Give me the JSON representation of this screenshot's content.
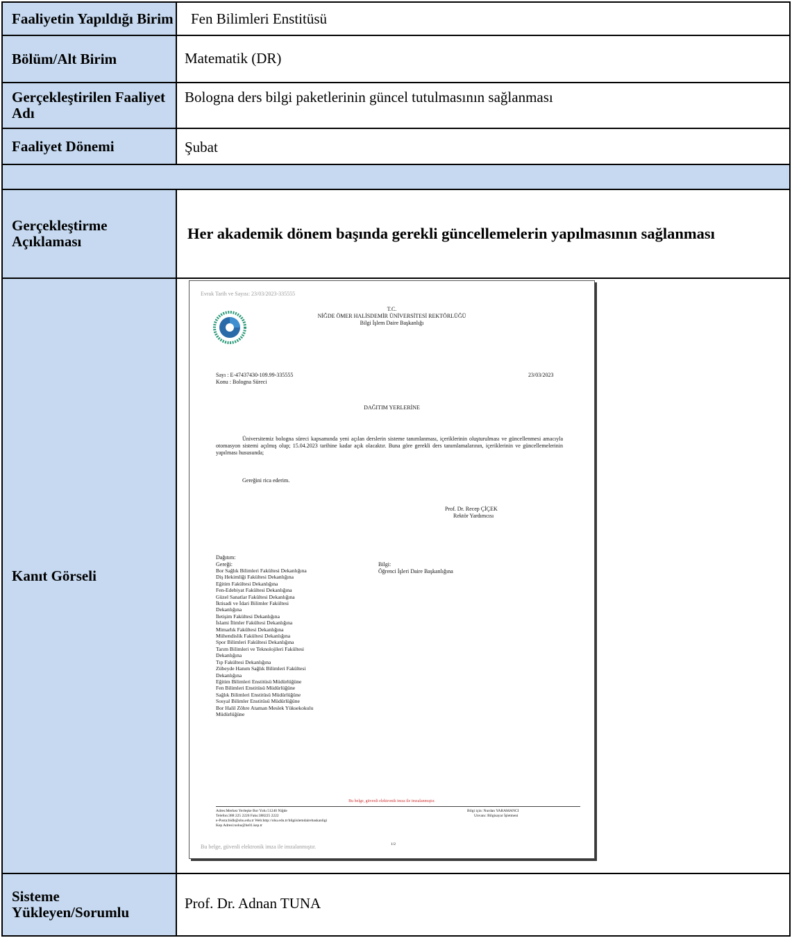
{
  "rows": {
    "birim": {
      "label": "Faaliyetin Yapıldığı Birim",
      "value": "Fen Bilimleri Enstitüsü"
    },
    "bolum": {
      "label": "Bölüm/Alt Birim",
      "value": "Matematik (DR)"
    },
    "faaliyet": {
      "label": "Gerçekleştirilen Faaliyet Adı",
      "value": "Bologna ders bilgi paketlerinin güncel tutulmasının sağlanması"
    },
    "donem": {
      "label": "Faaliyet Dönemi",
      "value": "Şubat"
    },
    "aciklama": {
      "label": "Gerçekleştirme Açıklaması",
      "value": "Her akademik dönem başında gerekli güncellemelerin yapılmasının sağlanması"
    },
    "kanit": {
      "label": "Kanıt Görseli"
    },
    "sorumlu": {
      "label": "Sisteme Yükleyen/Sorumlu",
      "value": "Prof. Dr. Adnan TUNA"
    }
  },
  "document": {
    "evrak": "Evrak Tarih ve Sayısı: 23/03/2023-335555",
    "header_tc": "T.C.",
    "header_univ": "NİĞDE ÖMER HALİSDEMİR ÜNİVERSİTESİ REKTÖRLÜĞÜ",
    "header_dept": "Bilgi İşlem Daire Başkanlığı",
    "sayi": "Sayı   : E-47437430-109.99-335555",
    "date": "23/03/2023",
    "konu": "Konu  : Bologna Süreci",
    "dagitim_heading": "DAĞITIM YERLERİNE",
    "body": "Üniversitemiz bologna süreci kapsamında yeni açılan derslerin sisteme tanımlanması, içeriklerinin oluşturulması ve güncellenmesi amacıyla otomasyon sistemi açılmış olup; 15.04.2023 tarihine kadar açık olacaktır. Buna göre gerekli ders tanımlamalarının, içeriklerinin ve güncellemelerinin yapılması hususunda;",
    "request": "Gereğini rica ederim.",
    "signer_name": "Prof. Dr. Recep ÇİÇEK",
    "signer_title": "Rektör Yardımcısı",
    "dagitim_label": "Dağıtım:",
    "geregi_label": "Gereği:",
    "bilgi_label": "Bilgi:",
    "bilgi_item": "Öğrenci İşleri Daire Başkanlığına",
    "geregi_list": [
      "Bor Sağlık Bilimleri Fakültesi Dekanlığına",
      "Diş Hekimliği Fakültesi Dekanlığına",
      "Eğitim Fakültesi Dekanlığına",
      "Fen-Edebiyat Fakültesi Dekanlığına",
      "Güzel Sanatlar Fakültesi Dekanlığına",
      "İktisadi ve İdari Bilimler Fakültesi",
      "Dekanlığına",
      "İletişim Fakültesi Dekanlığına",
      "İslami İlimler Fakültesi Dekanlığına",
      "Mimarlık Fakültesi Dekanlığına",
      "Mühendislik Fakültesi Dekanlığına",
      "Spor Bilimleri Fakültesi Dekanlığına",
      "Tarım Bilimleri ve Teknolojileri Fakültesi",
      "Dekanlığına",
      "Tıp Fakültesi Dekanlığına",
      "Zübeyde Hanım Sağlık Bilimleri Fakültesi",
      "Dekanlığına",
      "Eğitim Bilimleri Enstitüsü Müdürlüğüne",
      "Fen Bilimleri Enstitüsü Müdürlüğüne",
      "Sağlık Bilimleri Enstitüsü Müdürlüğüne",
      "Sosyal Bilimler Enstitüsü Müdürlüğüne",
      "Bor Halil Zöhre Ataman Meslek Yüksekokulu",
      "Müdürlüğüne"
    ],
    "red_notice": "Bu belge, güvenli elektronik imza ile imzalanmıştır.",
    "footer_left_1": "Adres:Merkez Yerleşke Bor Yolu 51240 Niğde",
    "footer_left_2": "Telefon:388 225 2226 Faks:388225 2222",
    "footer_left_3": "e-Posta:bidb@ohu.edu.tr Web:http://ohu.edu.tr/bilgiislemdairebaskanligi",
    "footer_left_4": "Kep Adresi:nohu@hs01.kep.tr",
    "footer_right_1": "Bilgi için: Nurdan YARAMANCI",
    "footer_right_2": "Unvanı: Bilgisayar İşletmeni",
    "bottom_notice": "Bu belge, güvenli elektronik imza ile imzalanmıştır.",
    "page_num": "1/2"
  },
  "colors": {
    "label_bg": "#c6d9f0",
    "border": "#000000",
    "notice_red": "#d03030"
  }
}
